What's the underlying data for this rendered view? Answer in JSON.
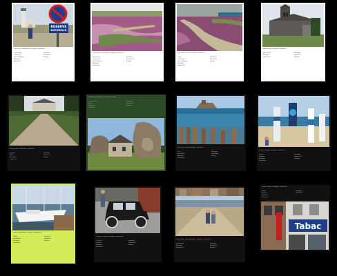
{
  "cards": [
    {
      "caption": "Cap Fréhel, Leuchtturm, Bretagne, Frankreich",
      "left_lines": [
        "Leuchtturm",
        "Cap Fréhel",
        "Cotes d'Armor",
        "Bretagne",
        "Frankreich"
      ],
      "right_lines": [
        "Bretagne",
        "Frankreich",
        "Europa"
      ],
      "sign_line1": "RESERVE",
      "sign_line2": "NATURELLE"
    },
    {
      "caption": "Cap Fréhel, Heidekraut, Bretagne, Frankreich",
      "left_lines": [
        "Heidekraut",
        "Cap Fréhel",
        "Cotes d'Armor",
        "Bretagne",
        "Frankreich"
      ],
      "right_lines": [
        "Bretagne",
        "Frankreich",
        "Europa"
      ]
    },
    {
      "caption": "Cap Fréhel, Küste, Bretagne, Frankreich",
      "left_lines": [
        "Küste",
        "Cap Fréhel",
        "Cotes d'Armor",
        "Bretagne",
        "Frankreich"
      ],
      "right_lines": [
        "Bretagne",
        "Frankreich",
        "Europa"
      ]
    },
    {
      "caption": "Abteikirche, Bretagne, Frankreich",
      "left_lines": [
        "Abteikirche",
        "Bretagne",
        "Frankreich"
      ],
      "right_lines": [
        "Bretagne",
        "Frankreich",
        "Europa"
      ]
    },
    {
      "caption": "Schloss, Allee, Bretagne, Frankreich",
      "left_lines": [
        "Schloss",
        "Allee",
        "Bretagne",
        "Frankreich"
      ],
      "right_lines": [
        "Bretagne",
        "Frankreich",
        "Europa"
      ]
    },
    {
      "caption": "Bretagne, Granitfelsen, Haus, Frankreich",
      "left_lines": [
        "Granitfelsen",
        "Haus",
        "Bretagne",
        "Frankreich"
      ],
      "right_lines": [
        "Bretagne",
        "Frankreich",
        "Europa"
      ]
    },
    {
      "caption": "Saint-Malo, Fort, Bretagne, Frankreich",
      "left_lines": [
        "Fort",
        "Saint-Malo",
        "Bretagne",
        "Frankreich"
      ],
      "right_lines": [
        "Bretagne",
        "Frankreich",
        "Europa"
      ]
    },
    {
      "caption": "Strand, Flaggen, Bretagne, Frankreich",
      "left_lines": [
        "Strand",
        "Flaggen",
        "Bretagne",
        "Frankreich"
      ],
      "right_lines": [
        "Bretagne",
        "Frankreich",
        "Europa"
      ]
    },
    {
      "caption": "Hafen, Segelboote, Bretagne, Frankreich",
      "left_lines": [
        "Hafen",
        "Segelboote",
        "Bretagne",
        "Frankreich"
      ],
      "right_lines": [
        "Bretagne",
        "Frankreich",
        "Europa"
      ]
    },
    {
      "caption": "Oldtimer, Strasse, Bretagne, Frankreich",
      "left_lines": [
        "Oldtimer",
        "Strasse",
        "Bretagne",
        "Frankreich"
      ],
      "right_lines": [
        "Bretagne",
        "Frankreich",
        "Europa"
      ]
    },
    {
      "caption": "Promenade, Spaziergaenger, Bretagne, Frankreich",
      "left_lines": [
        "Promenade",
        "Bretagne",
        "Frankreich"
      ],
      "right_lines": [
        "Bretagne",
        "Frankreich",
        "Europa"
      ]
    },
    {
      "caption": "Tabac, Strasse, Bretagne, Frankreich",
      "left_lines": [
        "Tabac",
        "Strasse",
        "Bretagne",
        "Frankreich"
      ],
      "right_lines": [
        "Bretagne",
        "Frankreich"
      ],
      "sign_text": "Tabac"
    }
  ]
}
